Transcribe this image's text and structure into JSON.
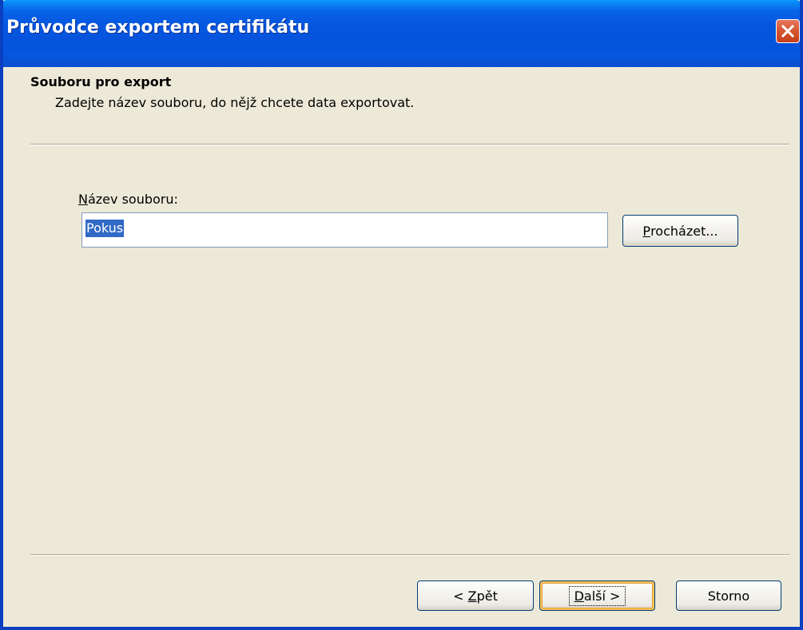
{
  "window": {
    "title": "Průvodce exportem certifikátu"
  },
  "header": {
    "title": "Souboru pro export",
    "subtitle": "Zadejte název souboru, do nějž chcete data exportovat."
  },
  "form": {
    "filename_label_accel": "N",
    "filename_label_rest": "ázev souboru:",
    "filename_value": "Pokus",
    "browse_accel": "P",
    "browse_rest": "rocházet..."
  },
  "buttons": {
    "back_prefix": "< ",
    "back_accel": "Z",
    "back_rest": "pět",
    "next_accel": "D",
    "next_rest": "alší >",
    "cancel_label": "Storno"
  },
  "colors": {
    "titlebar": "#0653dc",
    "dialog_background": "#ece9d8",
    "selection": "#316ac5",
    "close_button": "#d6542f"
  },
  "icons": {
    "close": "close-icon"
  }
}
